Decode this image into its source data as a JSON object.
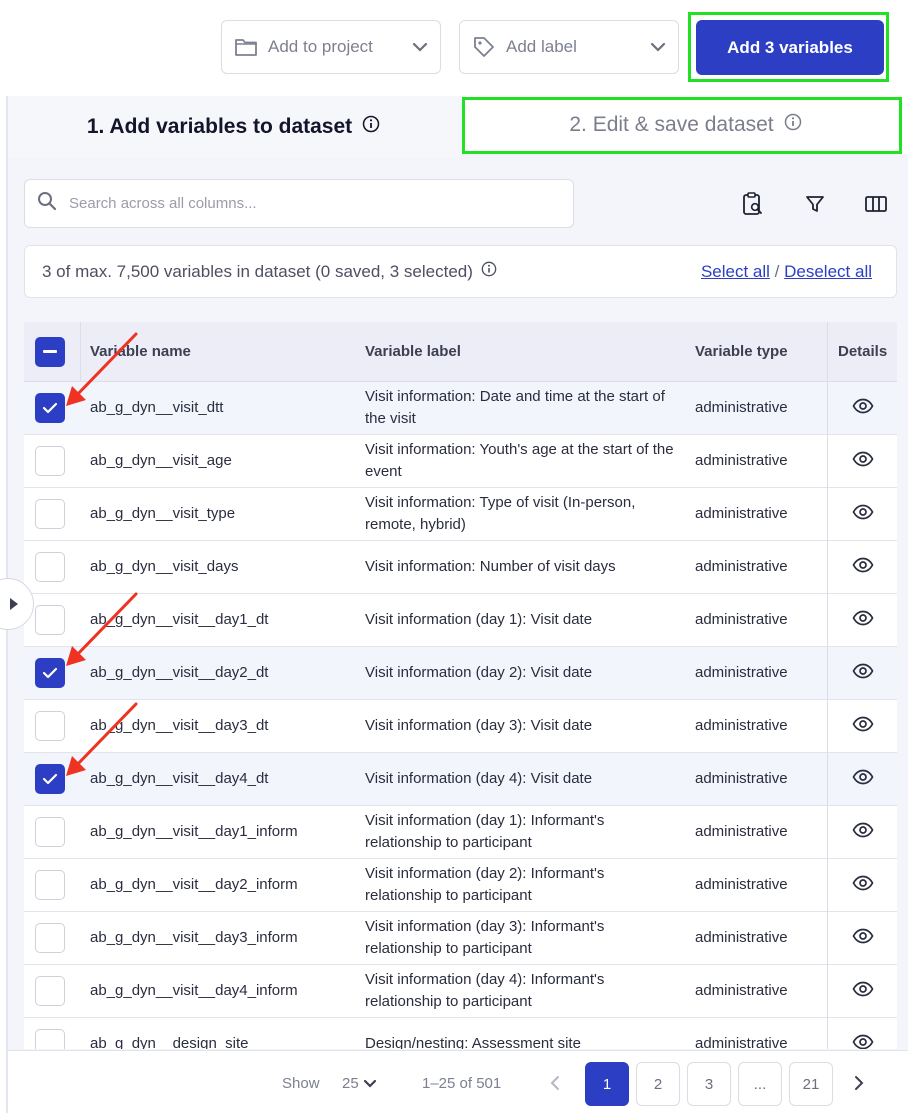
{
  "toolbar": {
    "add_to_project": "Add to project",
    "add_label": "Add label",
    "add_button": "Add 3 variables"
  },
  "tabs": [
    {
      "label": "1. Add variables to dataset",
      "active": true
    },
    {
      "label": "2. Edit & save dataset",
      "active": false
    }
  ],
  "search": {
    "placeholder": "Search across all columns..."
  },
  "status": {
    "text": "3 of max. 7,500 variables in dataset (0 saved, 3 selected)",
    "select_all": "Select all",
    "separator": "/",
    "deselect_all": "Deselect all"
  },
  "table": {
    "columns": [
      "Variable name",
      "Variable label",
      "Variable type",
      "Details"
    ],
    "rows": [
      {
        "name": "ab_g_dyn__visit_dtt",
        "label": "Visit information: Date and time at the start of the visit",
        "type": "administrative",
        "selected": true
      },
      {
        "name": "ab_g_dyn__visit_age",
        "label": "Visit information: Youth's age at the start of the event",
        "type": "administrative",
        "selected": false
      },
      {
        "name": "ab_g_dyn__visit_type",
        "label": "Visit information: Type of visit (In-person, remote, hybrid)",
        "type": "administrative",
        "selected": false
      },
      {
        "name": "ab_g_dyn__visit_days",
        "label": "Visit information: Number of visit days",
        "type": "administrative",
        "selected": false
      },
      {
        "name": "ab_g_dyn__visit__day1_dt",
        "label": "Visit information (day 1): Visit date",
        "type": "administrative",
        "selected": false
      },
      {
        "name": "ab_g_dyn__visit__day2_dt",
        "label": "Visit information (day 2): Visit date",
        "type": "administrative",
        "selected": true
      },
      {
        "name": "ab_g_dyn__visit__day3_dt",
        "label": "Visit information (day 3): Visit date",
        "type": "administrative",
        "selected": false
      },
      {
        "name": "ab_g_dyn__visit__day4_dt",
        "label": "Visit information (day 4): Visit date",
        "type": "administrative",
        "selected": true
      },
      {
        "name": "ab_g_dyn__visit__day1_inform",
        "label": "Visit information (day 1): Informant's relationship to participant",
        "type": "administrative",
        "selected": false
      },
      {
        "name": "ab_g_dyn__visit__day2_inform",
        "label": "Visit information (day 2): Informant's relationship to participant",
        "type": "administrative",
        "selected": false
      },
      {
        "name": "ab_g_dyn__visit__day3_inform",
        "label": "Visit information (day 3): Informant's relationship to participant",
        "type": "administrative",
        "selected": false
      },
      {
        "name": "ab_g_dyn__visit__day4_inform",
        "label": "Visit information (day 4): Informant's relationship to participant",
        "type": "administrative",
        "selected": false
      },
      {
        "name": "ab_g_dyn__design_site",
        "label": "Design/nesting: Assessment site",
        "type": "administrative",
        "selected": false
      }
    ]
  },
  "footer": {
    "show_label": "Show",
    "page_size": "25",
    "range": "1–25 of 501",
    "pages": [
      "1",
      "2",
      "3",
      "...",
      "21"
    ],
    "current_page": "1"
  },
  "colors": {
    "accent": "#2c3fc4",
    "highlight": "#22e022",
    "annotation_arrow": "#ee3322"
  }
}
